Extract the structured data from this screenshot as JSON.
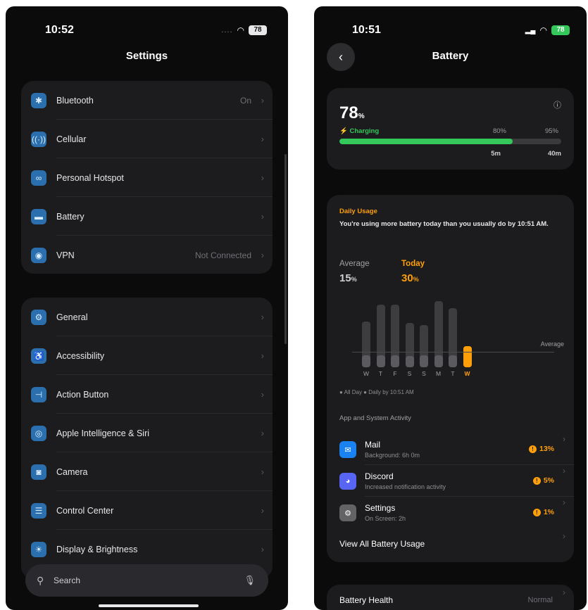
{
  "left": {
    "status": {
      "time": "10:52",
      "signal": "....",
      "battery": "78"
    },
    "title": "Settings",
    "group1": [
      {
        "label": "Bluetooth",
        "value": "On",
        "icon": "bluetooth-icon",
        "glyph": "✱"
      },
      {
        "label": "Cellular",
        "value": "",
        "icon": "cellular-icon",
        "glyph": "((·))"
      },
      {
        "label": "Personal Hotspot",
        "value": "",
        "icon": "hotspot-icon",
        "glyph": "∞"
      },
      {
        "label": "Battery",
        "value": "",
        "icon": "battery-icon",
        "glyph": "▬"
      },
      {
        "label": "VPN",
        "value": "Not Connected",
        "icon": "vpn-icon",
        "glyph": "◉"
      }
    ],
    "group2": [
      {
        "label": "General",
        "icon": "gear-icon",
        "glyph": "⚙"
      },
      {
        "label": "Accessibility",
        "icon": "accessibility-icon",
        "glyph": "♿"
      },
      {
        "label": "Action Button",
        "icon": "action-button-icon",
        "glyph": "⊣"
      },
      {
        "label": "Apple Intelligence & Siri",
        "icon": "siri-icon",
        "glyph": "◎"
      },
      {
        "label": "Camera",
        "icon": "camera-icon",
        "glyph": "◙"
      },
      {
        "label": "Control Center",
        "icon": "control-center-icon",
        "glyph": "☰"
      },
      {
        "label": "Display & Brightness",
        "icon": "brightness-icon",
        "glyph": "☀"
      }
    ],
    "search": {
      "label": "Search"
    }
  },
  "right": {
    "status": {
      "time": "10:51",
      "battery": "78"
    },
    "title": "Battery",
    "charge": {
      "percent": "78",
      "unit": "%",
      "status": "Charging",
      "level": 0.78,
      "marks": [
        "80%",
        "95%"
      ],
      "times": [
        "5m",
        "40m"
      ]
    },
    "daily": {
      "title": "Daily Usage",
      "message": "You're using more battery today than you usually do by 10:51 AM.",
      "average_label": "Average",
      "average_value": "15",
      "today_label": "Today",
      "today_value": "30",
      "unit": "%",
      "avg_line_label": "Average",
      "legend": "● All Day   ● Daily by 10:51 AM"
    },
    "chart_data": {
      "type": "bar",
      "categories": [
        "W",
        "T",
        "F",
        "S",
        "S",
        "M",
        "T",
        "W"
      ],
      "series": [
        {
          "values": [
            51,
            70,
            70,
            50,
            47,
            74,
            66,
            24
          ]
        },
        {
          "values": [
            13,
            13,
            13,
            13,
            13,
            13,
            13,
            24
          ]
        }
      ]
    },
    "activity": {
      "title": "App and System Activity",
      "apps": [
        {
          "name": "Mail",
          "sub": "Background: 6h 0m",
          "pct": "13%",
          "icon": "mail-icon",
          "glyph": "✉",
          "color": "#1a82f0"
        },
        {
          "name": "Discord",
          "sub": "Increased notification activity",
          "pct": "5%",
          "icon": "discord-icon",
          "glyph": "◕",
          "color": "#5865f2"
        },
        {
          "name": "Settings",
          "sub": "On Screen: 2h",
          "pct": "1%",
          "icon": "settings-icon",
          "glyph": "⚙",
          "color": "#636366"
        }
      ],
      "view_all": "View All Battery Usage"
    },
    "health": {
      "label": "Battery Health",
      "value": "Normal"
    }
  }
}
